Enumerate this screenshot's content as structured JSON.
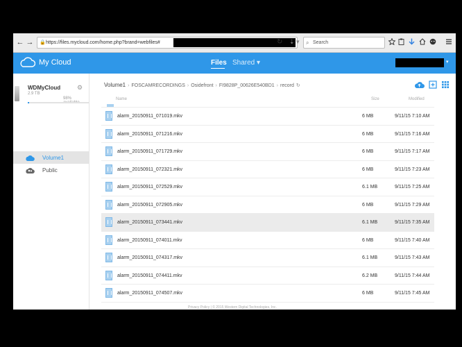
{
  "browser": {
    "url": "https://files.mycloud.com/home.php?brand=webfiles#",
    "search_placeholder": "Search",
    "lock": "🔒",
    "reload": "↻",
    "download_arrow": "⇣ ▾",
    "search_glyph": "⌕",
    "back": "←",
    "forward": "→"
  },
  "header": {
    "app_name": "My Cloud",
    "nav_files": "Files",
    "nav_shared": "Shared ▾",
    "user_caret": "▾",
    "accent_color": "#2f97e8"
  },
  "sidebar": {
    "device_name": "WDMyCloud",
    "device_size": "2.9 TB",
    "available": "98% available",
    "available_fraction": 0.02,
    "gear": "⚙",
    "items": [
      {
        "label": "Volume1",
        "icon": "cloud-icon",
        "active": true
      },
      {
        "label": "Public",
        "icon": "people-icon",
        "active": false
      }
    ]
  },
  "breadcrumb": {
    "items": [
      "Volume1",
      "FOSCAMRECORDINGS",
      "Osidefront",
      "FI9828P_00626E540BD1",
      "record"
    ],
    "separator": "›",
    "refresh": "↻"
  },
  "columns": {
    "name": "Name",
    "size": "Size",
    "modified": "Modified"
  },
  "files": [
    {
      "name": "alarm_20150911_071019.mkv",
      "size": "6 MB",
      "modified": "9/11/15 7:10 AM"
    },
    {
      "name": "alarm_20150911_071216.mkv",
      "size": "6 MB",
      "modified": "9/11/15 7:16 AM"
    },
    {
      "name": "alarm_20150911_071729.mkv",
      "size": "6 MB",
      "modified": "9/11/15 7:17 AM"
    },
    {
      "name": "alarm_20150911_072321.mkv",
      "size": "6 MB",
      "modified": "9/11/15 7:23 AM"
    },
    {
      "name": "alarm_20150911_072529.mkv",
      "size": "6.1 MB",
      "modified": "9/11/15 7:25 AM"
    },
    {
      "name": "alarm_20150911_072905.mkv",
      "size": "6 MB",
      "modified": "9/11/15 7:29 AM"
    },
    {
      "name": "alarm_20150911_073441.mkv",
      "size": "6.1 MB",
      "modified": "9/11/15 7:35 AM"
    },
    {
      "name": "alarm_20150911_074011.mkv",
      "size": "6 MB",
      "modified": "9/11/15 7:40 AM"
    },
    {
      "name": "alarm_20150911_074317.mkv",
      "size": "6.1 MB",
      "modified": "9/11/15 7:43 AM"
    },
    {
      "name": "alarm_20150911_074411.mkv",
      "size": "6.2 MB",
      "modified": "9/11/15 7:44 AM"
    },
    {
      "name": "alarm_20150911_074507.mkv",
      "size": "6 MB",
      "modified": "9/11/15 7:45 AM"
    }
  ],
  "selected_row": 6,
  "footer": "Privacy Policy  |  © 2015 Western Digital Technologies, Inc."
}
